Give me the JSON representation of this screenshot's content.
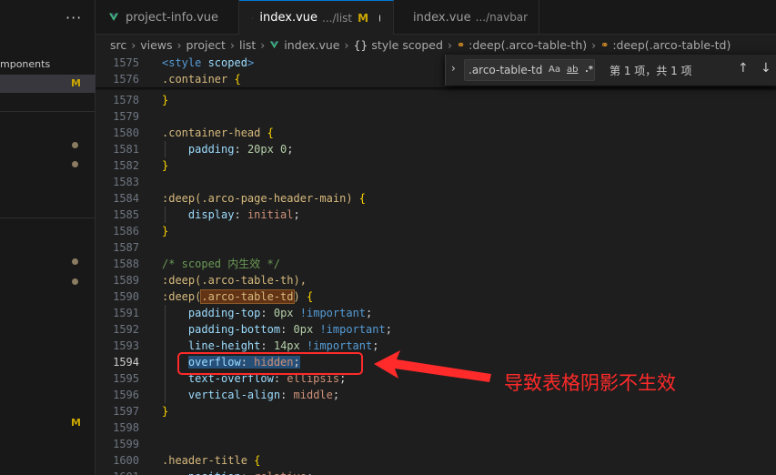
{
  "sidebar": {
    "more": "···",
    "folder_label": "mponents",
    "selected_badge": "M",
    "bottom_badge": "M"
  },
  "tabs": [
    {
      "label": "project-info.vue",
      "hint": "",
      "mod": ""
    },
    {
      "label": "index.vue",
      "hint": ".../list",
      "mod": "M"
    },
    {
      "label": "index.vue",
      "hint": ".../navbar",
      "mod": ""
    }
  ],
  "breadcrumb": {
    "parts": [
      "src",
      "views",
      "project",
      "list"
    ],
    "file": "index.vue",
    "scope": "style scoped",
    "sym1": ":deep(.arco-table-th)",
    "sym2": ":deep(.arco-table-td)"
  },
  "find": {
    "query": ".arco-table-td",
    "opt_case": "Aa",
    "opt_word": "ab",
    "opt_regex": ".*",
    "result": "第 1 项，共 1 项"
  },
  "lines": [
    1575,
    1576,
    1578,
    1579,
    1580,
    1581,
    1582,
    1583,
    1584,
    1585,
    1586,
    1587,
    1588,
    1589,
    1590,
    1591,
    1592,
    1593,
    1594,
    1595,
    1596,
    1597,
    1598,
    1599,
    1600,
    1601
  ],
  "code": {
    "l1575_tag": "<style",
    "l1575_attr": " scoped",
    "l1575_end": ">",
    "l1576_sel": ".container",
    "l1576_br": " {",
    "l1580_sel": ".container-head",
    "l1581_prop": "padding",
    "l1581_val": "20px 0",
    "l1584_pre": ":deep(",
    "l1584_sel": ".arco-page-header-main",
    "l1584_post": ")",
    "l1585_prop": "display",
    "l1585_val": "initial",
    "l1588_comment": "/* scoped 内生效 */",
    "l1589_pre": ":deep(",
    "l1589_sel": ".arco-table-th",
    "l1589_post": "),",
    "l1590_pre": ":deep(",
    "l1590_sel": ".arco-table-td",
    "l1590_post": ")",
    "l1591_prop": "padding-top",
    "l1591_val": "0px",
    "l1592_prop": "padding-bottom",
    "l1592_val": "0px",
    "l1593_prop": "line-height",
    "l1593_val": "14px",
    "important": "!important",
    "l1594_prop": "overflow",
    "l1594_val": "hidden",
    "l1595_prop": "text-overflow",
    "l1595_val": "ellipsis",
    "l1596_prop": "vertical-align",
    "l1596_val": "middle",
    "l1600_sel": ".header-title",
    "l1601_prop": "position",
    "l1601_val": "relative",
    "open_brace": "{",
    "close_brace": "}"
  },
  "annotation": {
    "text": "导致表格阴影不生效",
    "color": "#ff2a2a"
  }
}
